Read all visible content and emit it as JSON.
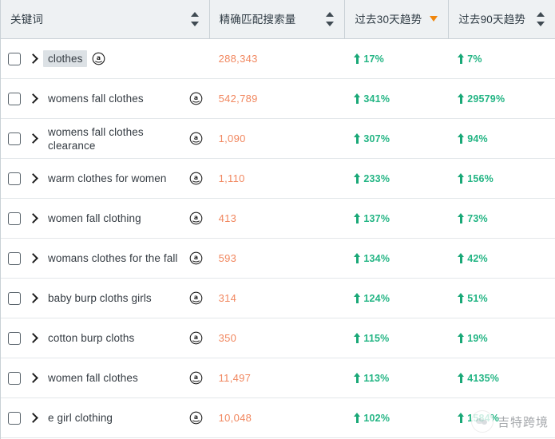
{
  "table": {
    "columns": [
      {
        "key": "keyword",
        "label": "关键词",
        "sort": "both"
      },
      {
        "key": "volume",
        "label": "精确匹配搜索量",
        "sort": "both"
      },
      {
        "key": "trend30",
        "label": "过去30天趋势",
        "sort": "desc"
      },
      {
        "key": "trend90",
        "label": "过去90天趋势",
        "sort": "both"
      }
    ],
    "rows": [
      {
        "keyword": "clothes",
        "highlight": true,
        "volume": "288,343",
        "trend30": "17%",
        "trend90": "7%"
      },
      {
        "keyword": "womens fall clothes",
        "highlight": false,
        "volume": "542,789",
        "trend30": "341%",
        "trend90": "29579%"
      },
      {
        "keyword": "womens fall clothes clearance",
        "highlight": false,
        "volume": "1,090",
        "trend30": "307%",
        "trend90": "94%"
      },
      {
        "keyword": "warm clothes for women",
        "highlight": false,
        "volume": "1,110",
        "trend30": "233%",
        "trend90": "156%"
      },
      {
        "keyword": "women fall clothing",
        "highlight": false,
        "volume": "413",
        "trend30": "137%",
        "trend90": "73%"
      },
      {
        "keyword": "womans clothes for the fall",
        "highlight": false,
        "volume": "593",
        "trend30": "134%",
        "trend90": "42%"
      },
      {
        "keyword": "baby burp cloths girls",
        "highlight": false,
        "volume": "314",
        "trend30": "124%",
        "trend90": "51%"
      },
      {
        "keyword": "cotton burp cloths",
        "highlight": false,
        "volume": "350",
        "trend30": "115%",
        "trend90": "19%"
      },
      {
        "keyword": "women fall clothes",
        "highlight": false,
        "volume": "11,497",
        "trend30": "113%",
        "trend90": "4135%"
      },
      {
        "keyword": "e girl clothing",
        "highlight": false,
        "volume": "10,048",
        "trend30": "102%",
        "trend90": "1584%"
      }
    ],
    "row_icon": "amazon-icon",
    "trend_direction_icon": "arrow-up-icon"
  },
  "watermark": {
    "text": "吉特跨境"
  },
  "colors": {
    "header_bg": "#eef1f3",
    "volume_text": "#f1875f",
    "trend_positive": "#19a877",
    "sort_active": "#f0860c",
    "highlight_bg": "#dce1e5"
  }
}
